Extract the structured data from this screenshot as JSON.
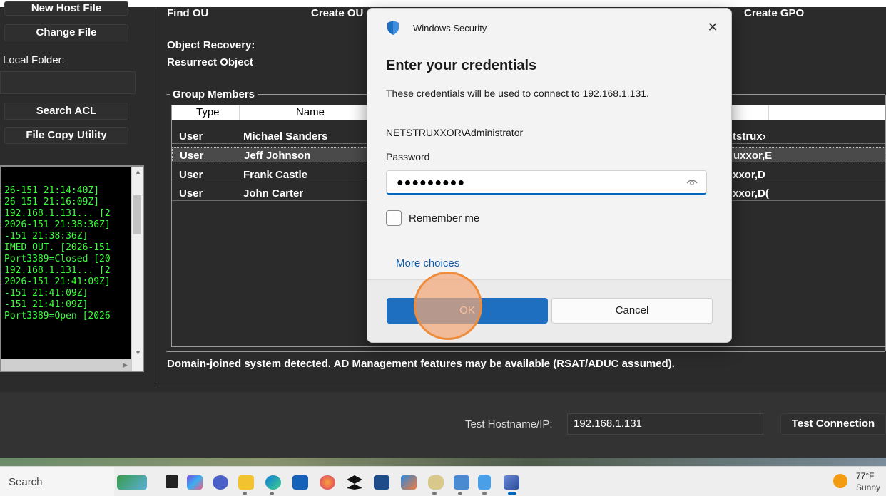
{
  "app": {
    "left_buttons": {
      "new_host_file": "New Host File",
      "change_file": "Change File",
      "search_acl": "Search ACL",
      "file_copy_utility": "File Copy Utility"
    },
    "local_folder_label": "Local Folder:",
    "log_lines": [
      "26-151 21:14:40Z]",
      "26-151 21:16:09Z]",
      "192.168.1.131... [2",
      "2026-151 21:38:36Z]",
      "-151 21:38:36Z]",
      "IMED OUT. [2026-151",
      "Port3389=Closed [20",
      "192.168.1.131... [2",
      "2026-151 21:41:09Z]",
      "-151 21:41:09Z]",
      "-151 21:41:09Z]",
      "Port3389=Open [2026"
    ],
    "top_links": {
      "find_ou": "Find OU",
      "create_ou": "Create OU",
      "create_gpo": "Create GPO",
      "object_recovery": "Object Recovery:",
      "resurrect_object": "Resurrect Object"
    },
    "group_members": {
      "title": "Group Members",
      "columns": [
        "Type",
        "Name"
      ],
      "rows": [
        {
          "type": "User",
          "name": "Michael Sanders",
          "dn_fragment": "tstrux›"
        },
        {
          "type": "User",
          "name": "Jeff Johnson",
          "dn_fragment": "uxxor,E"
        },
        {
          "type": "User",
          "name": "Frank Castle",
          "dn_fragment": "xxor,D"
        },
        {
          "type": "User",
          "name": "John Carter",
          "dn_fragment": "xxor,D("
        }
      ]
    },
    "status_message": "Domain-joined system detected. AD Management features may be available (RSAT/ADUC assumed).",
    "test_hostname_label": "Test Hostname/IP:",
    "test_hostname_value": "192.168.1.131",
    "test_connection_label": "Test Connection"
  },
  "dialog": {
    "window_title": "Windows Security",
    "heading": "Enter your credentials",
    "description": "These credentials will be used to connect to 192.168.1.131.",
    "username": "NETSTRUXXOR\\Administrator",
    "password_label": "Password",
    "password_value": "●●●●●●●●●",
    "remember_label": "Remember me",
    "remember_checked": false,
    "more_choices": "More choices",
    "ok_label": "OK",
    "cancel_label": "Cancel",
    "accent_color": "#1f6fc1"
  },
  "taskbar": {
    "search_label": "Search",
    "apps": [
      "widgets-icon",
      "task-view-icon",
      "m365-icon",
      "teams-icon",
      "file-explorer-icon",
      "edge-icon",
      "store-icon",
      "firefox-icon",
      "dropbox-icon",
      "powershell-icon",
      "remote-desktop-icon",
      "tools-icon",
      "network-icon",
      "notepad-icon",
      "active-app-icon"
    ],
    "weather_temp": "77°F",
    "weather_condition": "Sunny"
  }
}
